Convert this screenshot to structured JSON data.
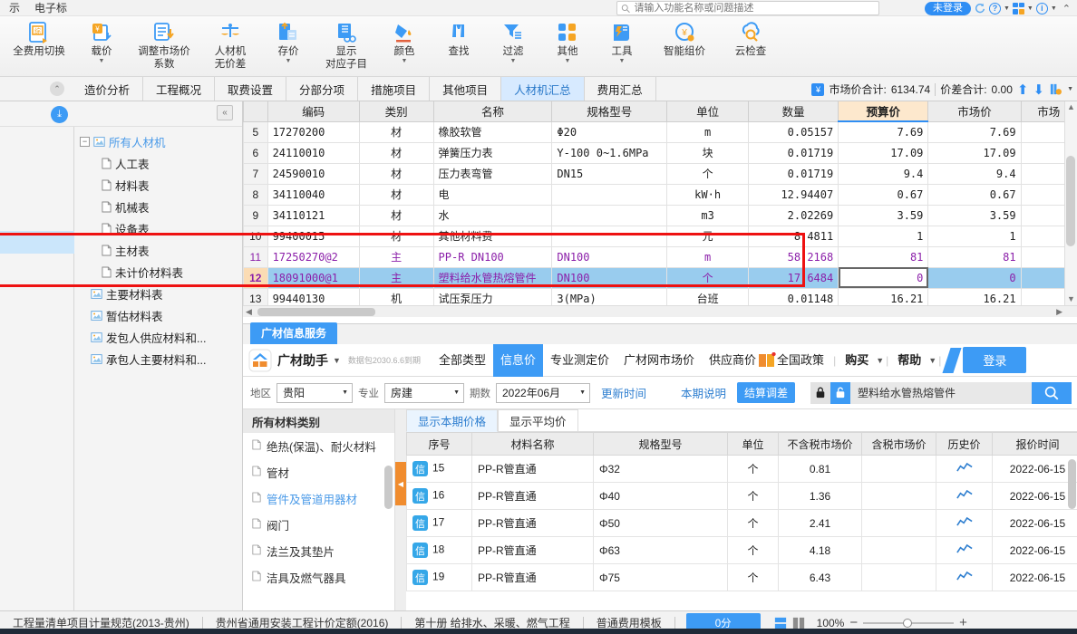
{
  "titlebar": {
    "menus": [
      "示",
      "电子标"
    ],
    "search_placeholder": "请输入功能名称或问题描述",
    "login_label": "未登录",
    "icons": [
      "refresh-icon",
      "help-icon",
      "apps-icon",
      "info-icon",
      "chevron-up-icon"
    ]
  },
  "ribbon": {
    "items": [
      {
        "label": "全费用切换",
        "sub": "",
        "icon": "switch-fee-icon",
        "dropdown": false
      },
      {
        "label": "载价",
        "sub": "",
        "icon": "load-price-icon",
        "dropdown": true
      },
      {
        "label": "调整市场价",
        "sub": "系数",
        "icon": "adjust-market-price-icon",
        "dropdown": false
      },
      {
        "label": "人材机",
        "sub": "无价差",
        "icon": "balance-icon",
        "dropdown": false
      },
      {
        "label": "存价",
        "sub": "",
        "icon": "save-price-icon",
        "dropdown": true
      },
      {
        "label": "显示",
        "sub": "对应子目",
        "icon": "show-subitem-icon",
        "dropdown": false
      },
      {
        "label": "颜色",
        "sub": "",
        "icon": "color-icon",
        "dropdown": true
      },
      {
        "label": "查找",
        "sub": "",
        "icon": "find-icon",
        "dropdown": false
      },
      {
        "label": "过滤",
        "sub": "",
        "icon": "filter-icon",
        "dropdown": true
      },
      {
        "label": "其他",
        "sub": "",
        "icon": "other-icon",
        "dropdown": true
      },
      {
        "label": "工具",
        "sub": "",
        "icon": "tools-icon",
        "dropdown": true
      },
      {
        "label": "智能组价",
        "sub": "",
        "icon": "smart-price-icon",
        "dropdown": false
      },
      {
        "label": "云检查",
        "sub": "",
        "icon": "cloud-check-icon",
        "dropdown": false
      }
    ]
  },
  "tabs": [
    {
      "label": "造价分析",
      "active": false
    },
    {
      "label": "工程概况",
      "active": false
    },
    {
      "label": "取费设置",
      "active": false
    },
    {
      "label": "分部分项",
      "active": false
    },
    {
      "label": "措施项目",
      "active": false
    },
    {
      "label": "其他项目",
      "active": false
    },
    {
      "label": "人材机汇总",
      "active": true
    },
    {
      "label": "费用汇总",
      "active": false
    }
  ],
  "tabs_right": {
    "market_total_label": "市场价合计:",
    "market_total_value": "6134.74",
    "diff_total_label": "价差合计:",
    "diff_total_value": "0.00"
  },
  "tree": {
    "root": "所有人材机",
    "children": [
      "人工表",
      "材料表",
      "机械表",
      "设备表",
      "主材表",
      "未计价材料表"
    ],
    "siblings": [
      "主要材料表",
      "暂估材料表",
      "发包人供应材料和...",
      "承包人主要材料和..."
    ]
  },
  "grid": {
    "columns": [
      "",
      "编码",
      "类别",
      "名称",
      "规格型号",
      "单位",
      "数量",
      "预算价",
      "市场价",
      "市场"
    ],
    "highlight_column": "预算价",
    "rows": [
      {
        "no": "5",
        "code": "17270200",
        "cat": "材",
        "name": "橡胶软管",
        "spec": "Φ20",
        "unit": "m",
        "qty": "0.05157",
        "budget": "7.69",
        "market": "7.69",
        "style": ""
      },
      {
        "no": "6",
        "code": "24110010",
        "cat": "材",
        "name": "弹簧压力表",
        "spec": "Y-100 0~1.6MPa",
        "unit": "块",
        "qty": "0.01719",
        "budget": "17.09",
        "market": "17.09",
        "style": ""
      },
      {
        "no": "7",
        "code": "24590010",
        "cat": "材",
        "name": "压力表弯管",
        "spec": "DN15",
        "unit": "个",
        "qty": "0.01719",
        "budget": "9.4",
        "market": "9.4",
        "style": ""
      },
      {
        "no": "8",
        "code": "34110040",
        "cat": "材",
        "name": "电",
        "spec": "",
        "unit": "kW·h",
        "qty": "12.94407",
        "budget": "0.67",
        "market": "0.67",
        "style": ""
      },
      {
        "no": "9",
        "code": "34110121",
        "cat": "材",
        "name": "水",
        "spec": "",
        "unit": "m3",
        "qty": "2.02269",
        "budget": "3.59",
        "market": "3.59",
        "style": ""
      },
      {
        "no": "10",
        "code": "99400015",
        "cat": "材",
        "name": "其他材料费",
        "spec": "",
        "unit": "元",
        "qty": "8.4811",
        "budget": "1",
        "market": "1",
        "style": "clipped"
      },
      {
        "no": "11",
        "code": "17250270@2",
        "cat": "主",
        "name": "PP-R DN100",
        "spec": "DN100",
        "unit": "m",
        "qty": "58.2168",
        "budget": "81",
        "market": "81",
        "style": "purple"
      },
      {
        "no": "12",
        "code": "18091000@1",
        "cat": "主",
        "name": "塑料给水管热熔管件",
        "spec": "DN100",
        "unit": "个",
        "qty": "17.6484",
        "budget": "0",
        "market": "0",
        "style": "selected"
      },
      {
        "no": "13",
        "code": "99440130",
        "cat": "机",
        "name": "试压泵压力",
        "spec": "3(MPa)",
        "unit": "台班",
        "qty": "0.01148",
        "budget": "16.21",
        "market": "16.21",
        "style": "clipped"
      }
    ]
  },
  "gc": {
    "panel_tab": "广材信息服务",
    "brand": "广材助手",
    "expire": "数据包2030.6.6到期",
    "nav": [
      {
        "label": "全部类型",
        "active": false
      },
      {
        "label": "信息价",
        "active": true
      },
      {
        "label": "专业测定价",
        "active": false
      },
      {
        "label": "广材网市场价",
        "active": false
      },
      {
        "label": "供应商价",
        "active": false
      },
      {
        "label": "全国政策",
        "active": false
      }
    ],
    "nav_right": [
      {
        "label": "购买",
        "dropdown": true
      },
      {
        "label": "帮助",
        "dropdown": true
      }
    ],
    "login_label": "登录",
    "filters": {
      "region_label": "地区",
      "region_value": "贵阳",
      "major_label": "专业",
      "major_value": "房建",
      "period_label": "期数",
      "period_value": "2022年06月",
      "update_time_label": "更新时间",
      "note_label": "本期说明",
      "settle_label": "结算调差",
      "search_value": "塑料给水管热熔管件"
    },
    "categories_header": "所有材料类别",
    "categories": [
      {
        "label": "绝热(保温)、耐火材料",
        "sel": false
      },
      {
        "label": "管材",
        "sel": false
      },
      {
        "label": "管件及管道用器材",
        "sel": true
      },
      {
        "label": "阀门",
        "sel": false
      },
      {
        "label": "法兰及其垫片",
        "sel": false
      },
      {
        "label": "洁具及燃气器具",
        "sel": false
      }
    ],
    "list_tabs": [
      {
        "label": "显示本期价格",
        "active": true
      },
      {
        "label": "显示平均价",
        "active": false
      }
    ],
    "list_columns": [
      "序号",
      "材料名称",
      "规格型号",
      "单位",
      "不含税市场价",
      "含税市场价",
      "历史价",
      "报价时间"
    ],
    "list_rows": [
      {
        "no": "15",
        "name": "PP-R管直通",
        "spec": "Φ32",
        "unit": "个",
        "price_ex": "0.81",
        "price_inc": "",
        "history": "trend-icon",
        "date": "2022-06-15"
      },
      {
        "no": "16",
        "name": "PP-R管直通",
        "spec": "Φ40",
        "unit": "个",
        "price_ex": "1.36",
        "price_inc": "",
        "history": "trend-icon",
        "date": "2022-06-15"
      },
      {
        "no": "17",
        "name": "PP-R管直通",
        "spec": "Φ50",
        "unit": "个",
        "price_ex": "2.41",
        "price_inc": "",
        "history": "trend-icon",
        "date": "2022-06-15"
      },
      {
        "no": "18",
        "name": "PP-R管直通",
        "spec": "Φ63",
        "unit": "个",
        "price_ex": "4.18",
        "price_inc": "",
        "history": "trend-icon",
        "date": "2022-06-15"
      },
      {
        "no": "19",
        "name": "PP-R管直通",
        "spec": "Φ75",
        "unit": "个",
        "price_ex": "6.43",
        "price_inc": "",
        "history": "trend-icon",
        "date": "2022-06-15"
      }
    ]
  },
  "statusbar": {
    "items": [
      "工程量清单项目计量规范(2013-贵州)",
      "贵州省通用安装工程计价定额(2016)",
      "第十册 给排水、采暖、燃气工程",
      "普通费用模板"
    ],
    "score": "0分",
    "zoom": "100%"
  },
  "colors": {
    "accent": "#3d9bf5",
    "highlight_header": "#fde8cd",
    "selected_row": "#99ccee",
    "red_box": "#ee1111",
    "orange": "#f08c2e"
  }
}
